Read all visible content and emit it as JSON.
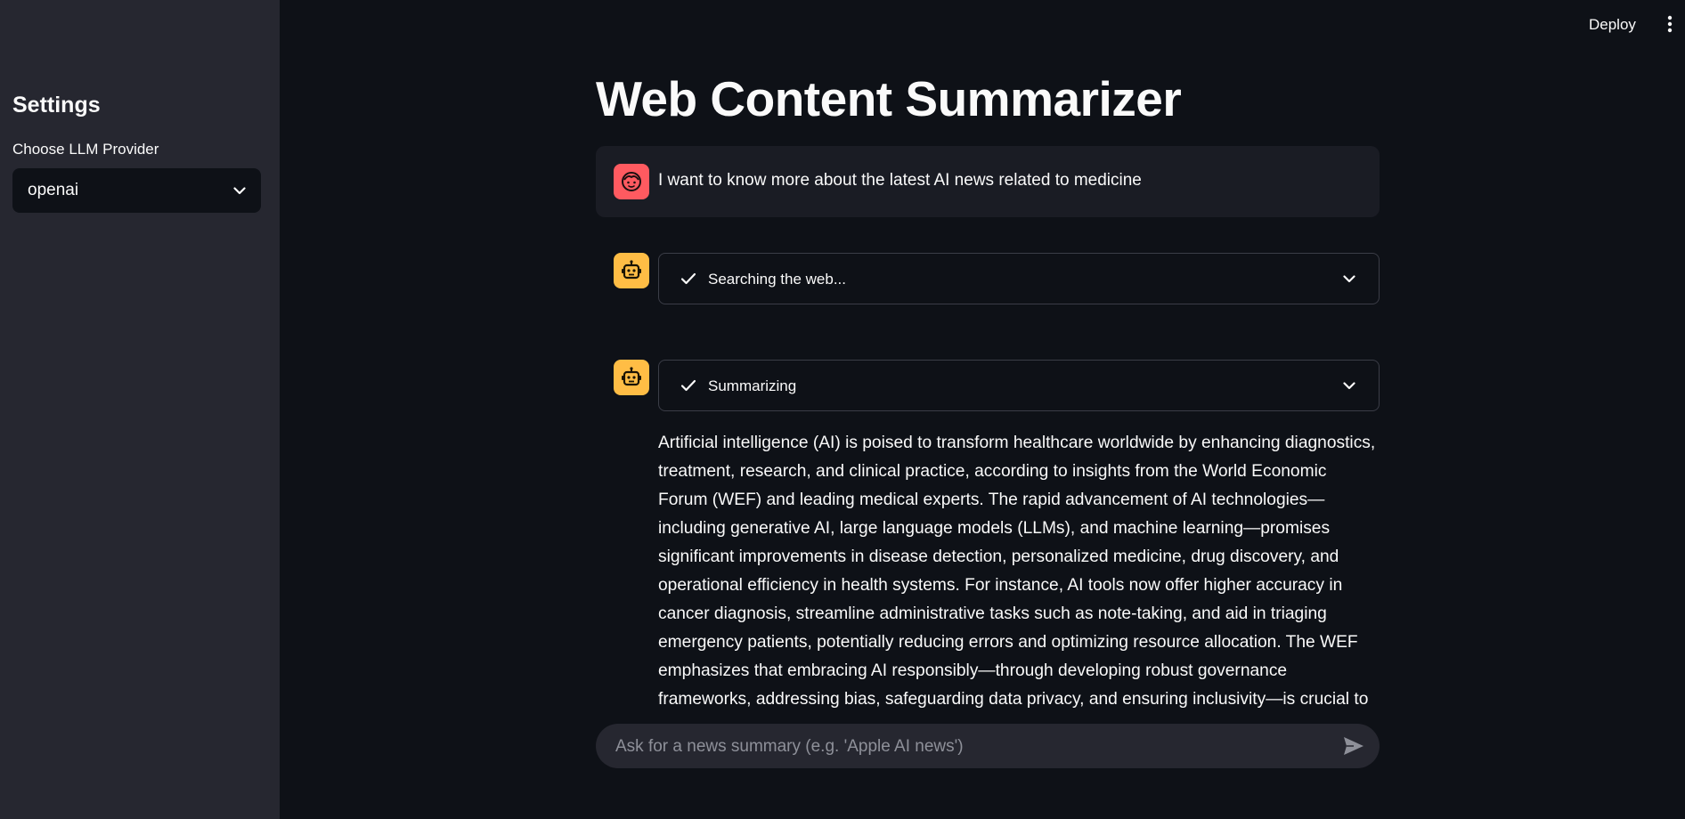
{
  "sidebar": {
    "title": "Settings",
    "select_label": "Choose LLM Provider",
    "select_value": "openai"
  },
  "header": {
    "deploy_label": "Deploy",
    "menu_icon": "more-vertical-icon"
  },
  "main": {
    "title": "Web Content Summarizer",
    "user_message": "I want to know more about the latest AI news related to medicine",
    "steps": [
      {
        "label": "Searching the web...",
        "status_icon": "check-icon"
      },
      {
        "label": "Summarizing",
        "status_icon": "check-icon"
      }
    ],
    "summary": "Artificial intelligence (AI) is poised to transform healthcare worldwide by enhancing diagnostics, treatment, research, and clinical practice, according to insights from the World Economic Forum (WEF) and leading medical experts. The rapid advancement of AI technologies—including generative AI, large language models (LLMs), and machine learning—promises significant improvements in disease detection, personalized medicine, drug discovery, and operational efficiency in health systems. For instance, AI tools now offer higher accuracy in cancer diagnosis, streamline administrative tasks such as note-taking, and aid in triaging emergency patients, potentially reducing errors and optimizing resource allocation. The WEF emphasizes that embracing AI responsibly—through developing robust governance frameworks, addressing bias, safeguarding data privacy, and ensuring inclusivity—is crucial to maximize benefits while"
  },
  "chat_input": {
    "placeholder": "Ask for a news summary (e.g. 'Apple AI news')"
  },
  "colors": {
    "background": "#0e1117",
    "sidebar": "#262730",
    "user_avatar": "#ff5a60",
    "bot_avatar": "#ffbd45"
  }
}
